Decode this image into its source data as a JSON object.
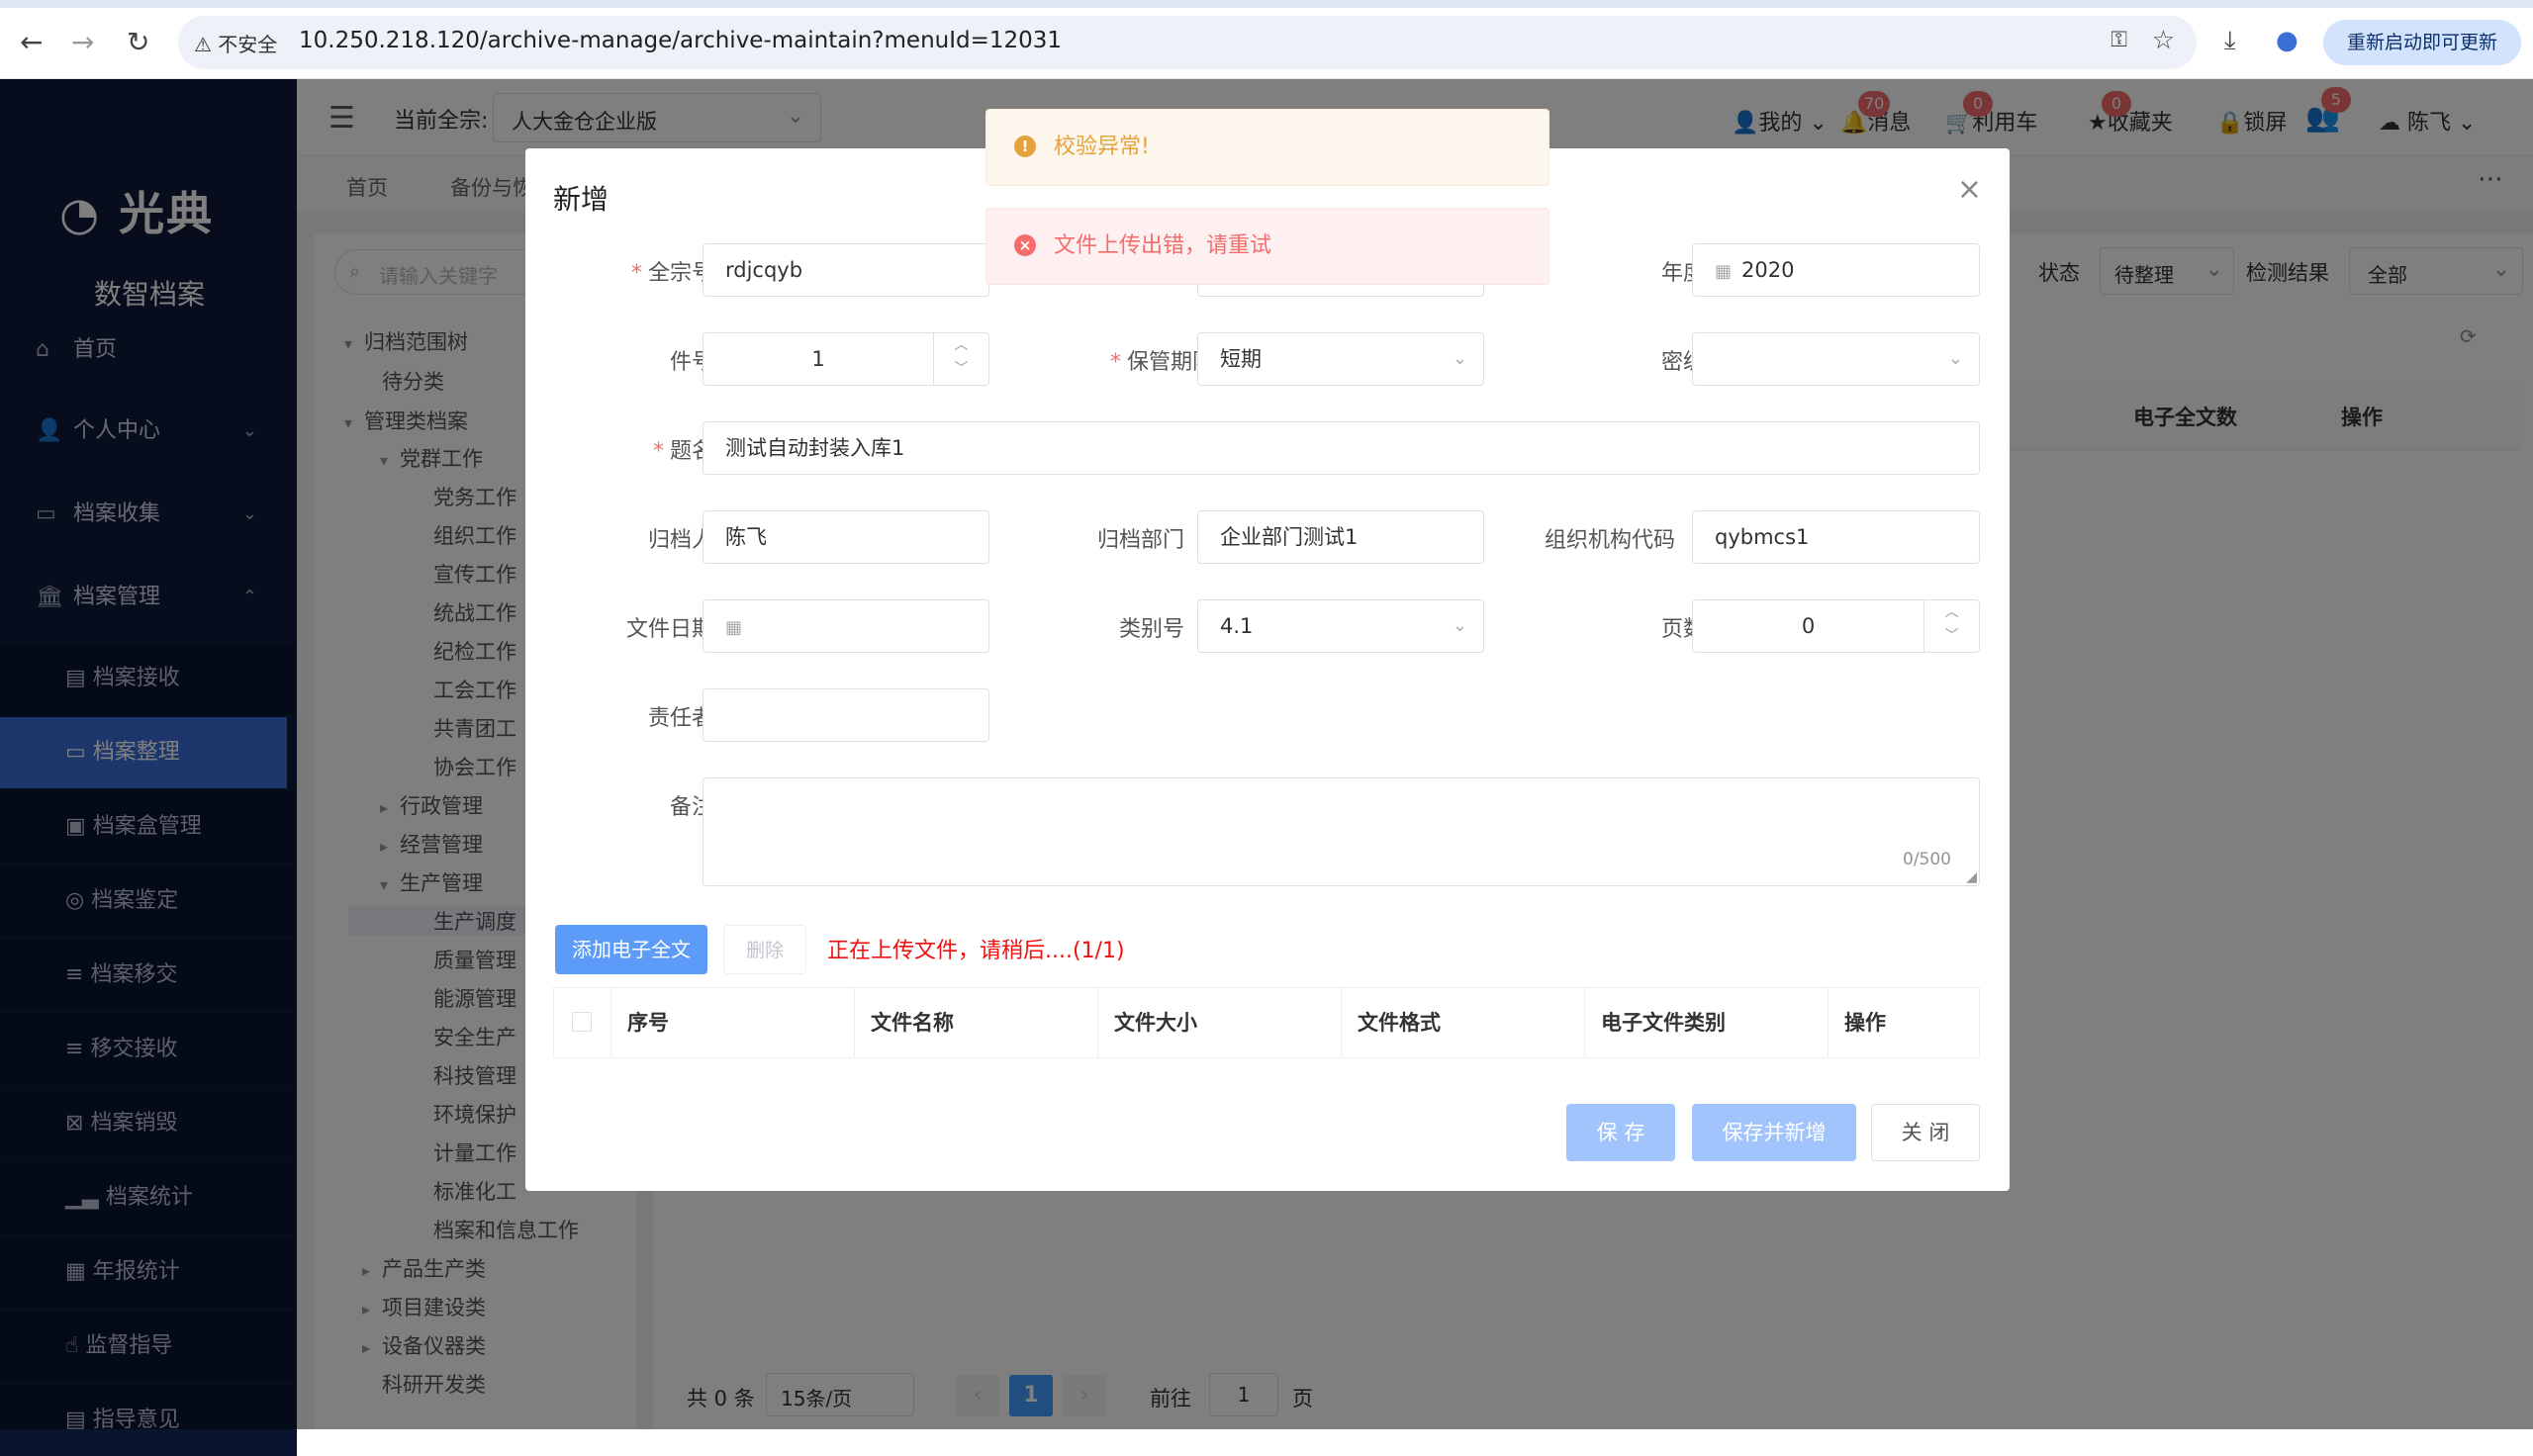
{
  "browser": {
    "security_label": "不安全",
    "url": "10.250.218.120/archive-manage/archive-maintain?menuId=12031",
    "relaunch_label": "重新启动即可更新"
  },
  "brand": {
    "logo": "光典",
    "subtitle": "数智档案"
  },
  "sidebar": {
    "items": [
      {
        "label": "首页"
      },
      {
        "label": "个人中心"
      },
      {
        "label": "档案收集"
      },
      {
        "label": "档案管理"
      }
    ],
    "subitems": [
      {
        "label": "档案接收"
      },
      {
        "label": "档案整理"
      },
      {
        "label": "档案盒管理"
      },
      {
        "label": "档案鉴定"
      },
      {
        "label": "档案移交"
      },
      {
        "label": "移交接收"
      },
      {
        "label": "档案销毁"
      },
      {
        "label": "档案统计"
      },
      {
        "label": "年报统计"
      },
      {
        "label": "监督指导"
      },
      {
        "label": "指导意见"
      }
    ]
  },
  "header": {
    "fonds_label": "当前全宗:",
    "fonds_value": "人大金仓企业版",
    "mine": "我的",
    "messages": "消息",
    "messages_count": "70",
    "cart": "利用车",
    "cart_count": "0",
    "favorites": "收藏夹",
    "favorites_count": "0",
    "lock": "锁屏",
    "user_count": "5",
    "user": "陈飞"
  },
  "tabs": [
    "首页",
    "备份与恢"
  ],
  "tree": {
    "search_placeholder": "请输入关键字",
    "nodes": [
      "归档范围树",
      "待分类",
      "管理类档案",
      "党群工作",
      "党务工作",
      "组织工作",
      "宣传工作",
      "统战工作",
      "纪检工作",
      "工会工作",
      "共青团工",
      "协会工作",
      "行政管理",
      "经营管理",
      "生产管理",
      "生产调度",
      "质量管理",
      "能源管理",
      "安全生产",
      "科技管理",
      "环境保护",
      "计量工作",
      "标准化工",
      "档案和信息工作",
      "产品生产类",
      "项目建设类",
      "设备仪器类",
      "科研开发类"
    ]
  },
  "filters": {
    "status_label": "状态",
    "status_value": "待整理",
    "result_label": "检测结果",
    "result_value": "全部"
  },
  "main_table": {
    "col_count": "电子全文数",
    "col_ops": "操作"
  },
  "pagination": {
    "total": "共 0 条",
    "page_size": "15条/页",
    "current": "1",
    "goto_label": "前往",
    "goto_value": "1",
    "page_unit": "页"
  },
  "modal": {
    "title": "新增",
    "fields": {
      "fonds": {
        "label": "全宗号",
        "value": "rdjcqyb"
      },
      "year": {
        "label": "年度",
        "value": "2020"
      },
      "item_no": {
        "label": "件号",
        "value": "1"
      },
      "retention": {
        "label": "保管期限",
        "value": "短期"
      },
      "secret": {
        "label": "密级",
        "value": ""
      },
      "title": {
        "label": "题名",
        "value": "测试自动封装入库1"
      },
      "archiver": {
        "label": "归档人",
        "value": "陈飞"
      },
      "dept": {
        "label": "归档部门",
        "value": "企业部门测试1"
      },
      "org_code": {
        "label": "组织机构代码",
        "value": "qybmcs1"
      },
      "file_date": {
        "label": "文件日期",
        "value": ""
      },
      "category": {
        "label": "类别号",
        "value": "4.1"
      },
      "pages": {
        "label": "页数",
        "value": "0"
      },
      "responsible": {
        "label": "责任者",
        "value": ""
      },
      "remark": {
        "label": "备注",
        "value": "",
        "counter": "0/500"
      }
    },
    "add_file_btn": "添加电子全文",
    "delete_btn": "删除",
    "upload_status": "正在上传文件，请稍后....(1/1)",
    "file_columns": [
      "序号",
      "文件名称",
      "文件大小",
      "文件格式",
      "电子文件类别",
      "操作"
    ],
    "save_btn": "保 存",
    "save_new_btn": "保存并新增",
    "close_btn": "关 闭"
  },
  "toasts": {
    "warning": "校验异常!",
    "error": "文件上传出错，请重试"
  }
}
